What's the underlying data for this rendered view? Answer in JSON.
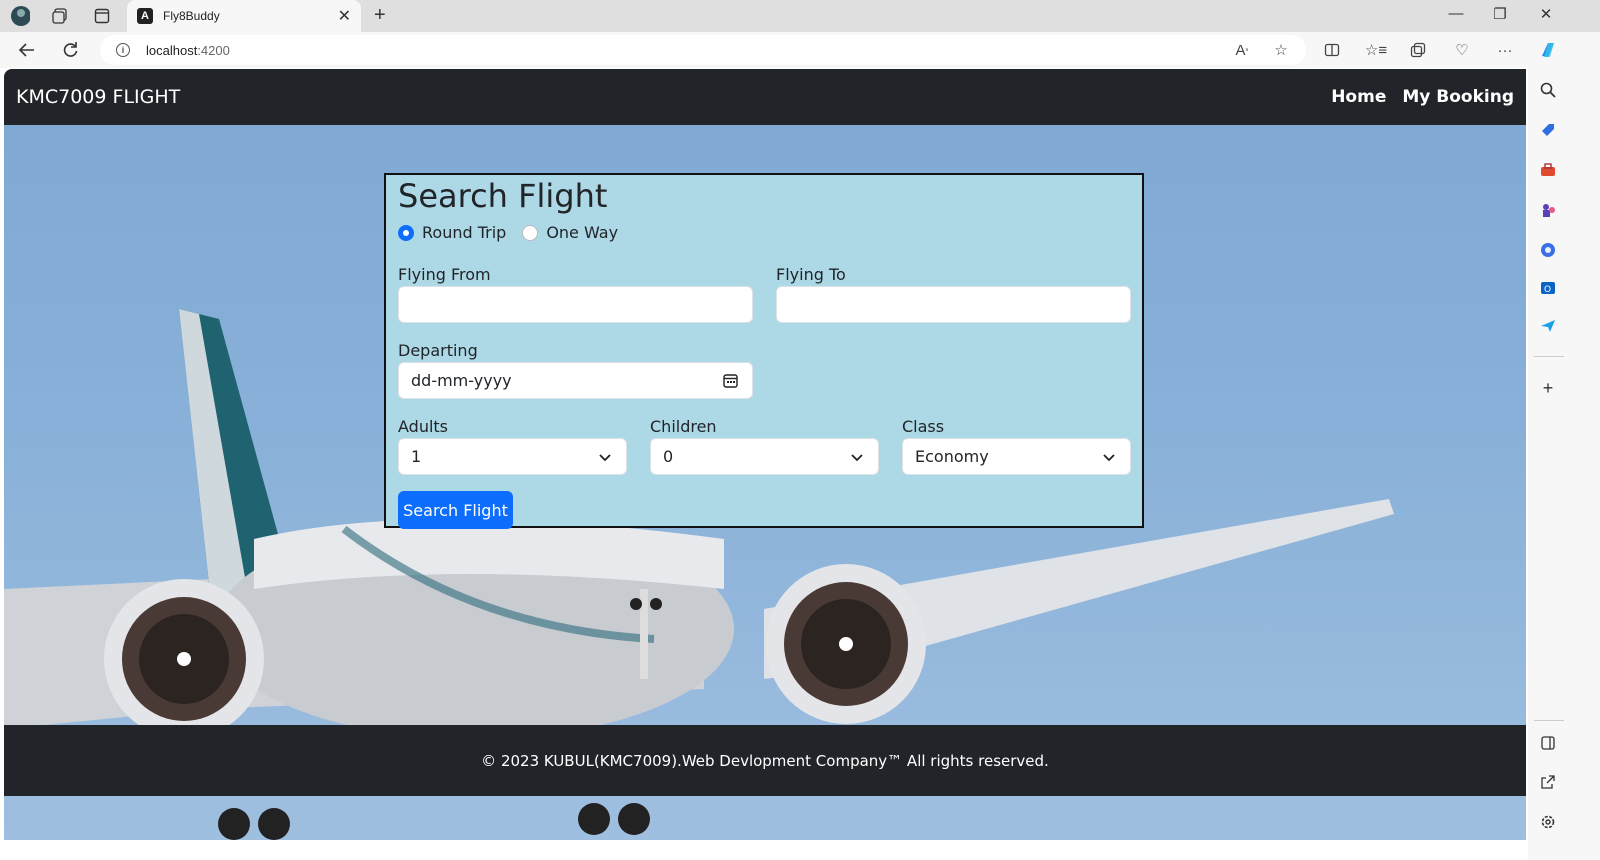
{
  "browser": {
    "tab_title": "Fly8Buddy",
    "url_host": "localhost",
    "url_port": ":4200",
    "tab_favicon_letter": "A"
  },
  "app": {
    "brand": "KMC7009 FLIGHT",
    "nav": {
      "home": "Home",
      "my_booking": "My Booking"
    },
    "search": {
      "heading": "Search Flight",
      "trip_types": {
        "round_trip": "Round Trip",
        "one_way": "One Way"
      },
      "selected_trip": "Round Trip",
      "flying_from_label": "Flying From",
      "flying_from_value": "",
      "flying_to_label": "Flying To",
      "flying_to_value": "",
      "departing_label": "Departing",
      "departing_placeholder": "dd-mm-yyyy",
      "adults_label": "Adults",
      "adults_value": "1",
      "children_label": "Children",
      "children_value": "0",
      "class_label": "Class",
      "class_value": "Economy",
      "submit_label": "Search Flight"
    },
    "footer": "© 2023 KUBUL(KMC7009).Web Devlopment Company™ All rights reserved."
  },
  "colors": {
    "navbar": "#212529",
    "card": "#add8e6",
    "primary": "#0d6efd",
    "sky": "#88b0d8"
  }
}
